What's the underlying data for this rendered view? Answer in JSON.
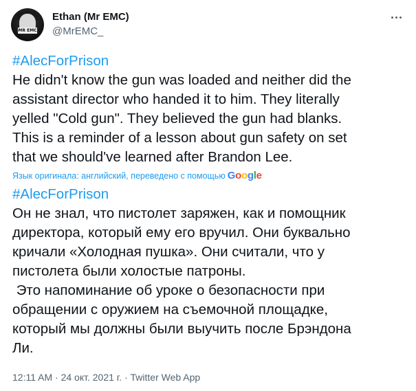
{
  "author": {
    "name": "Ethan (Mr EMC)",
    "handle": "@MrEMC_",
    "avatar_tag": "MR EMC"
  },
  "original": {
    "hashtag": "#AlecForPrison",
    "lines": [
      "He didn't know the gun was loaded and neither did the",
      "assistant director who handed it to him. They literally",
      "yelled \"Cold gun\". They believed the gun had blanks.",
      "This is a reminder of a lesson about gun safety on set",
      "that we should've learned after Brandon Lee."
    ]
  },
  "translation_note": "Язык оригинала: английский, переведено с помощью",
  "translation_provider": "Google",
  "translated": {
    "hashtag": "#AlecForPrison",
    "lines": [
      "Он не знал, что пистолет заряжен, как и помощник",
      "директора, который ему его вручил. Они буквально",
      "кричали «Холодная пушка». Они считали, что у",
      "пистолета были холостые патроны.",
      " Это напоминание об уроке о безопасности при",
      "обращении с оружием на съемочной площадке,",
      "который мы должны были выучить после Брэндона",
      "Ли."
    ]
  },
  "meta": {
    "time": "12:11 AM",
    "date": "24 окт. 2021 г.",
    "source": "Twitter Web App",
    "separator": "·"
  },
  "icons": {
    "more": "more-horizontal-icon"
  }
}
